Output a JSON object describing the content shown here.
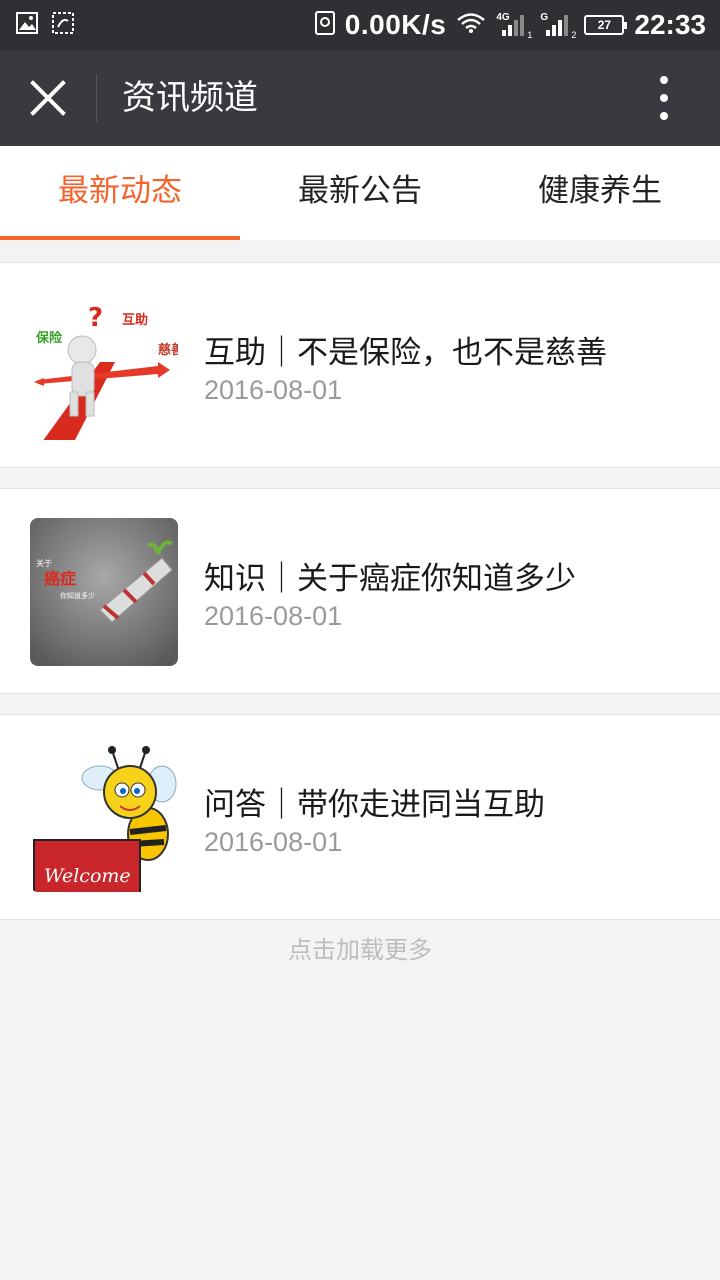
{
  "status_bar": {
    "net_speed": "0.00K/s",
    "network_4g": "4G",
    "sim1": "1",
    "network_g": "G",
    "sim2": "2",
    "battery_level": "27",
    "time": "22:33"
  },
  "title_bar": {
    "title": "资讯频道"
  },
  "tabs": [
    {
      "label": "最新动态",
      "active": true
    },
    {
      "label": "最新公告",
      "active": false
    },
    {
      "label": "健康养生",
      "active": false
    }
  ],
  "news": [
    {
      "title": "互助｜不是保险，也不是慈善",
      "date": "2016-08-01",
      "thumb_text": {
        "a": "保险",
        "b": "互助",
        "c": "慈善"
      }
    },
    {
      "title": "知识｜关于癌症你知道多少",
      "date": "2016-08-01",
      "thumb_text": {
        "a": "关于",
        "b": "癌症",
        "c": "你知道多少"
      }
    },
    {
      "title": "问答｜带你走进同当互助",
      "date": "2016-08-01",
      "thumb_text": {
        "a": "Welcome"
      }
    }
  ],
  "load_more": "点击加载更多",
  "colors": {
    "accent": "#f5632c",
    "header_bg": "#393a3f",
    "status_bg": "#2f3033"
  }
}
